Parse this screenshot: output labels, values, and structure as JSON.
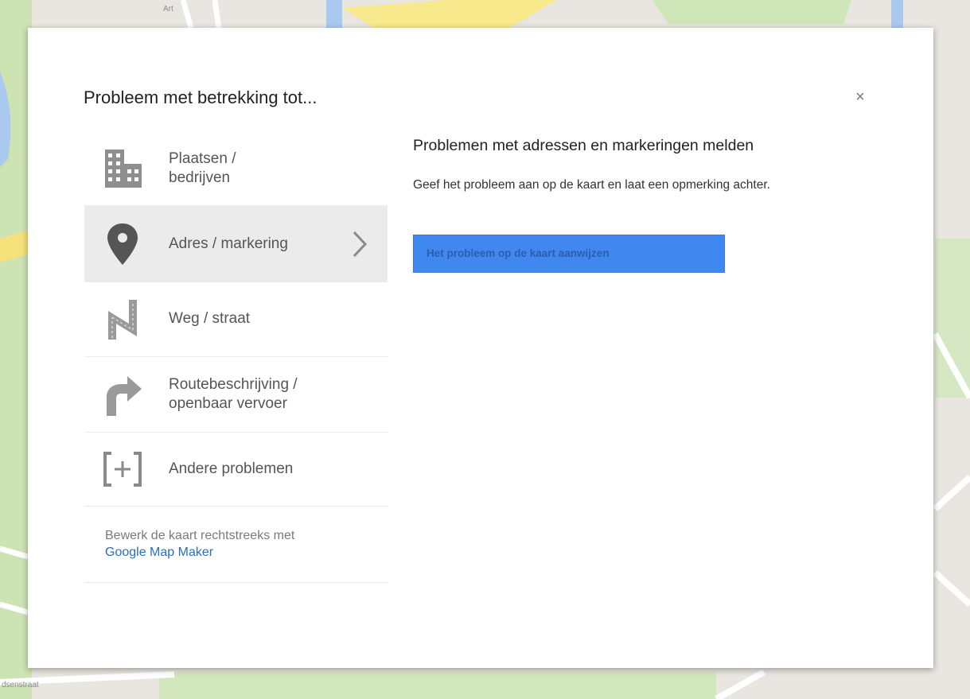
{
  "dialog": {
    "title": "Probleem met betrekking tot...",
    "close_label": "×"
  },
  "categories": [
    {
      "label": "Plaatsen /\nbedrijven",
      "icon": "building-icon",
      "selected": false
    },
    {
      "label": "Adres / markering",
      "icon": "map-pin-icon",
      "selected": true
    },
    {
      "label": "Weg / straat",
      "icon": "road-icon",
      "selected": false
    },
    {
      "label": "Routebeschrijving /\nopenbaar vervoer",
      "icon": "turn-arrow-icon",
      "selected": false
    },
    {
      "label": "Andere problemen",
      "icon": "bracket-plus-icon",
      "selected": false
    }
  ],
  "footer": {
    "note": "Bewerk de kaart rechtstreeks met",
    "link": "Google Map Maker"
  },
  "panel": {
    "heading": "Problemen met adressen en markeringen melden",
    "description": "Geef het probleem aan op de kaart en laat een opmerking achter.",
    "button_label": "Het probleem op de kaart aanwijzen"
  },
  "map_labels": [
    "dsenstraat",
    "Art"
  ],
  "colors": {
    "accent_button": "#4187f0",
    "link": "#2a6ec2",
    "selected_row": "#ebebeb"
  }
}
